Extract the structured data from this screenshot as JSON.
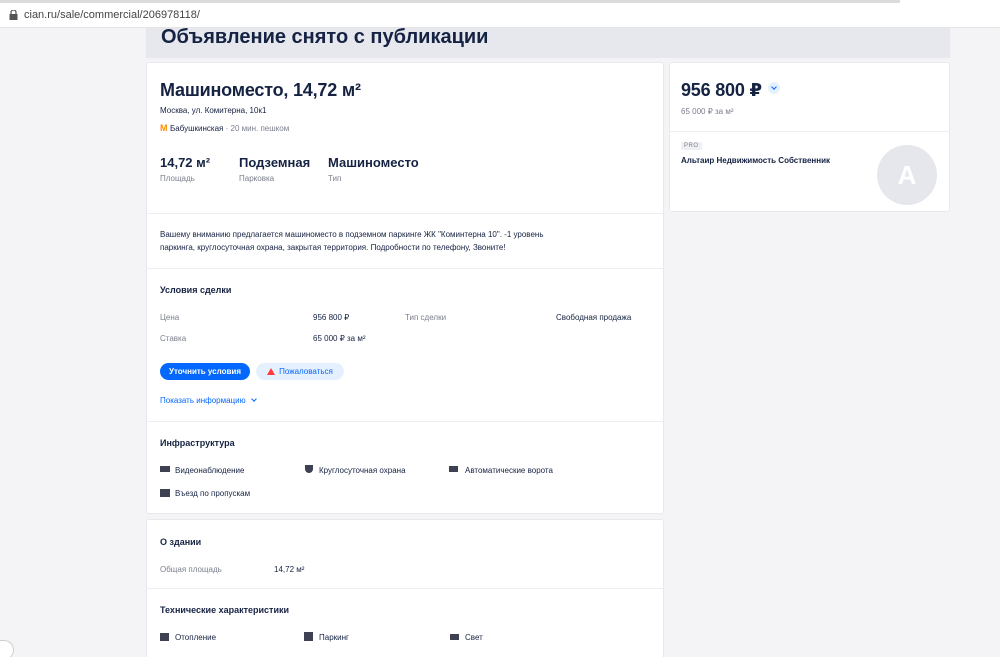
{
  "browser": {
    "url": "cian.ru/sale/commercial/206978118/"
  },
  "banner": {
    "text": "Объявление снято с публикации"
  },
  "listing": {
    "title": "Машиноместо, 14,72 м²",
    "address": "Москва, ул. Комитерна, 10к1",
    "metro": {
      "station": "Бабушкинская",
      "walk": "· 20 мин. пешком"
    },
    "specs": [
      {
        "value": "14,72 м²",
        "label": "Площадь"
      },
      {
        "value": "Подземная",
        "label": "Парковка"
      },
      {
        "value": "Машиноместо",
        "label": "Тип"
      }
    ],
    "description_line1": "Вашему вниманию предлагается машиноместо в подземном паркинге ЖК \"Коминтерна 10\". -1 уровень",
    "description_line2": "паркинга, круглосуточная охрана, закрытая территория. Подробности по телефону, Звоните!"
  },
  "deal": {
    "heading": "Условия сделки",
    "price_label": "Цена",
    "price_value": "956 800 ₽",
    "deal_type_label": "Тип сделки",
    "deal_type_value": "Свободная продажа",
    "rate_label": "Ставка",
    "rate_value": "65 000 ₽ за м²",
    "clarify_button": "Уточнить условия",
    "complain_button": "Пожаловаться",
    "show_info_link": "Показать информацию"
  },
  "infrastructure": {
    "heading": "Инфраструктура",
    "items": [
      "Видеонаблюдение",
      "Круглосуточная охрана",
      "Автоматические ворота",
      "Въезд по пропускам"
    ]
  },
  "building": {
    "heading": "О здании",
    "area_label": "Общая площадь",
    "area_value": "14,72 м²"
  },
  "technical": {
    "heading": "Технические характеристики",
    "items": [
      "Отопление",
      "Паркинг",
      "Свет"
    ]
  },
  "sidebar": {
    "price": "956 800 ₽",
    "price_per_m2": "65 000 ₽ за м²",
    "badge": "PRO",
    "agent_name": "Альтаир Недвижимость Собственник",
    "avatar_letter": "A"
  },
  "colors": {
    "accent": "#0468ff",
    "metro": "#ff8a00",
    "warning": "#ff3b3b"
  }
}
